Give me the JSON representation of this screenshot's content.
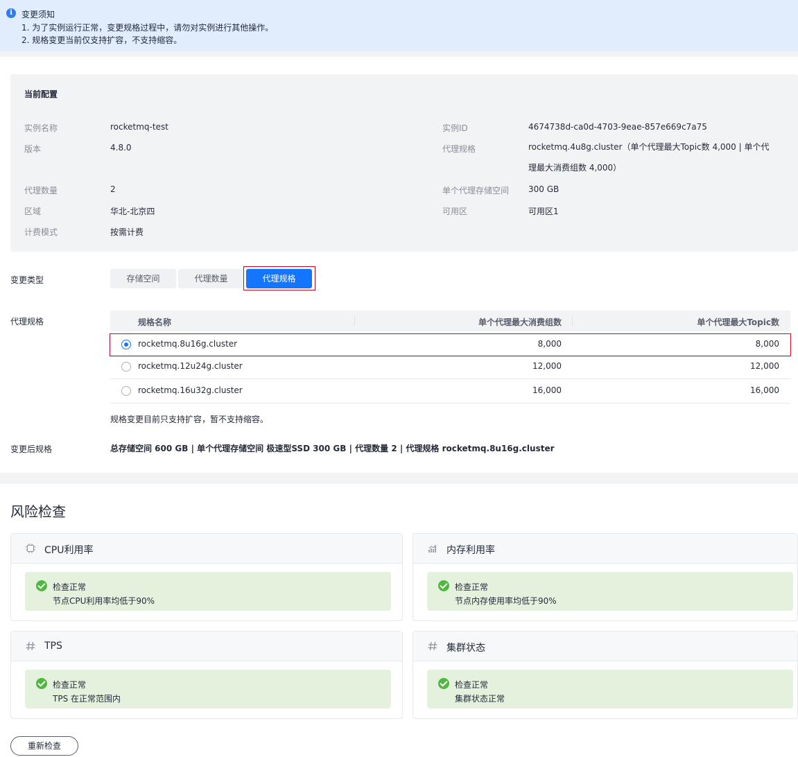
{
  "notice": {
    "title": "变更须知",
    "line1": "1. 为了实例运行正常，变更规格过程中，请勿对实例进行其他操作。",
    "line2": "2. 规格变更当前仅支持扩容，不支持缩容。"
  },
  "current_config": {
    "title": "当前配置",
    "instance_name_label": "实例名称",
    "instance_name": "rocketmq-test",
    "version_label": "版本",
    "version": "4.8.0",
    "broker_count_label": "代理数量",
    "broker_count": "2",
    "region_label": "区域",
    "region": "华北-北京四",
    "billing_label": "计费模式",
    "billing": "按需计费",
    "instance_id_label": "实例ID",
    "instance_id": "4674738d-ca0d-4703-9eae-857e669c7a75",
    "broker_spec_label": "代理规格",
    "broker_spec": "rocketmq.4u8g.cluster（单个代理最大Topic数 4,000 | 单个代理最大消费组数 4,000）",
    "storage_label": "单个代理存储空间",
    "storage": "300 GB",
    "az_label": "可用区",
    "az": "可用区1"
  },
  "change_type": {
    "label": "变更类型",
    "options": [
      "存储空间",
      "代理数量",
      "代理规格"
    ],
    "selected": "代理规格"
  },
  "spec_table": {
    "label": "代理规格",
    "headers": [
      "规格名称",
      "单个代理最大消费组数",
      "单个代理最大Topic数"
    ],
    "rows": [
      {
        "name": "rocketmq.8u16g.cluster",
        "groups": "8,000",
        "topics": "8,000",
        "selected": true
      },
      {
        "name": "rocketmq.12u24g.cluster",
        "groups": "12,000",
        "topics": "12,000",
        "selected": false
      },
      {
        "name": "rocketmq.16u32g.cluster",
        "groups": "16,000",
        "topics": "16,000",
        "selected": false
      }
    ],
    "hint": "规格变更目前只支持扩容，暂不支持缩容。"
  },
  "after_change": {
    "label": "变更后规格",
    "summary": "总存储空间 600 GB | 单个代理存储空间 极速型SSD 300 GB | 代理数量 2 | 代理规格 rocketmq.8u16g.cluster"
  },
  "risk_check": {
    "title": "风险检查",
    "cards": [
      {
        "icon": "cpu-icon",
        "title": "CPU利用率",
        "status": "检查正常",
        "detail": "节点CPU利用率均低于90%"
      },
      {
        "icon": "chart-icon",
        "title": "内存利用率",
        "status": "检查正常",
        "detail": "节点内存使用率均低于90%"
      },
      {
        "icon": "hash-icon",
        "title": "TPS",
        "status": "检查正常",
        "detail": "TPS 在正常范围内"
      },
      {
        "icon": "hash-icon",
        "title": "集群状态",
        "status": "检查正常",
        "detail": "集群状态正常"
      }
    ],
    "recheck_label": "重新检查"
  },
  "colors": {
    "primary": "#1476ff",
    "success": "#50b840",
    "notice_bg": "#e1ecfd",
    "highlight_frame": "#d0021b"
  }
}
